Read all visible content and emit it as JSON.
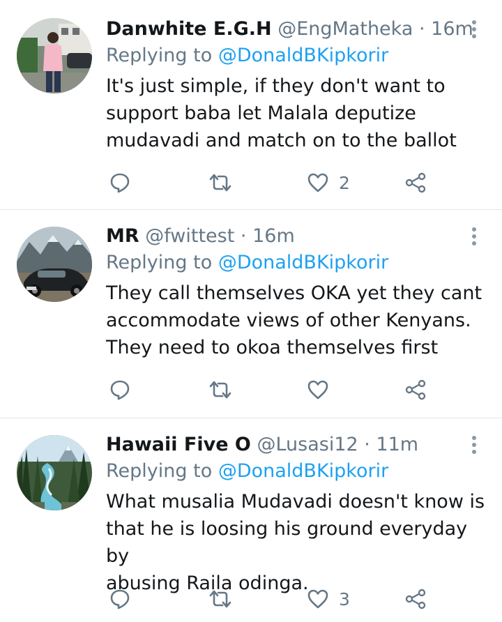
{
  "tweets": [
    {
      "name": "Danwhite E.G.H",
      "handle": "@EngMatheka",
      "separator": "·",
      "time": "16m",
      "replying_label": "Replying to",
      "replying_to": "@DonaldBKipkorir",
      "text": "It's just simple, if they don't want to\nsupport baba let Malala deputize\nmudavadi and match on to the ballot",
      "like_count": "2",
      "avatar": "man-in-pink-shirt-photo"
    },
    {
      "name": "MR",
      "handle": "@fwittest",
      "separator": "·",
      "time": "16m",
      "replying_label": "Replying to",
      "replying_to": "@DonaldBKipkorir",
      "text": "They call themselves OKA yet they cant\naccommodate views of other Kenyans.\nThey need to okoa themselves first",
      "like_count": "",
      "avatar": "vintage-car-mountains-photo"
    },
    {
      "name": "Hawaii Five O",
      "handle": "@Lusasi12",
      "separator": "·",
      "time": "11m",
      "replying_label": "Replying to",
      "replying_to": "@DonaldBKipkorir",
      "text": "What musalia Mudavadi doesn't know is\nthat he is loosing his ground everyday by\nabusing Raila odinga.",
      "like_count": "3",
      "avatar": "river-forest-landscape-photo"
    }
  ],
  "icons": {
    "reply": "speech-bubble-icon",
    "retweet": "retweet-arrows-icon",
    "like": "heart-icon",
    "share": "share-nodes-icon",
    "more": "vertical-dots-icon"
  },
  "colors": {
    "text": "#14171a",
    "secondary": "#657786",
    "link": "#1da1f2",
    "divider": "#e1e8ed"
  }
}
